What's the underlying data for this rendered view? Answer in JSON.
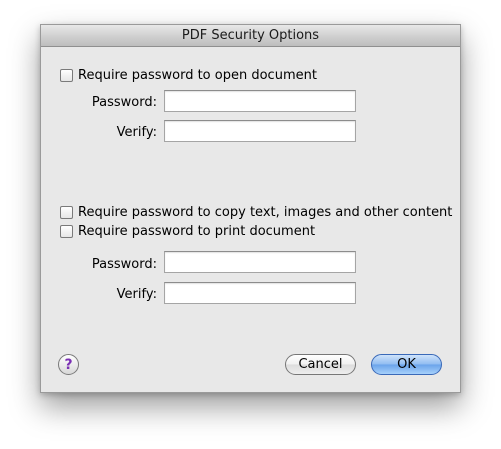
{
  "dialog": {
    "title": "PDF Security Options"
  },
  "open_section": {
    "checkbox_label": "Require password to open document",
    "password_label": "Password:",
    "verify_label": "Verify:",
    "password_value": "",
    "verify_value": ""
  },
  "permissions_section": {
    "copy_checkbox_label": "Require password to copy text, images and other content",
    "print_checkbox_label": "Require password to print document",
    "password_label": "Password:",
    "verify_label": "Verify:",
    "password_value": "",
    "verify_value": ""
  },
  "footer": {
    "help_symbol": "?",
    "cancel_label": "Cancel",
    "ok_label": "OK"
  },
  "colors": {
    "window_bg": "#e8e8e8",
    "default_button": "#6aa3ea",
    "help_glyph": "#7a2fb4"
  }
}
